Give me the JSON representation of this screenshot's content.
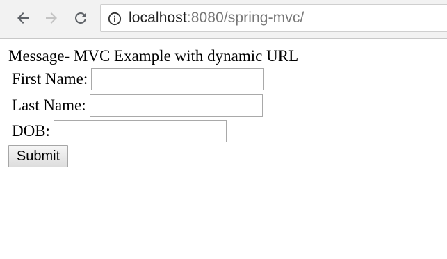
{
  "browser": {
    "url_host": "localhost",
    "url_rest": ":8080/spring-mvc/",
    "icons": {
      "back": "arrow-back-icon",
      "forward": "arrow-forward-icon",
      "reload": "reload-icon",
      "info": "info-icon"
    },
    "colors": {
      "toolbar_bg": "#f2f2f2",
      "icon_active": "#5f6368",
      "icon_disabled": "#c4c4c4"
    }
  },
  "page": {
    "message": "Message- MVC Example with dynamic URL",
    "form": {
      "first_name_label": "First Name:",
      "first_name_value": "",
      "last_name_label": "Last Name:",
      "last_name_value": "",
      "dob_label": "DOB:",
      "dob_value": "",
      "submit_label": "Submit"
    }
  }
}
